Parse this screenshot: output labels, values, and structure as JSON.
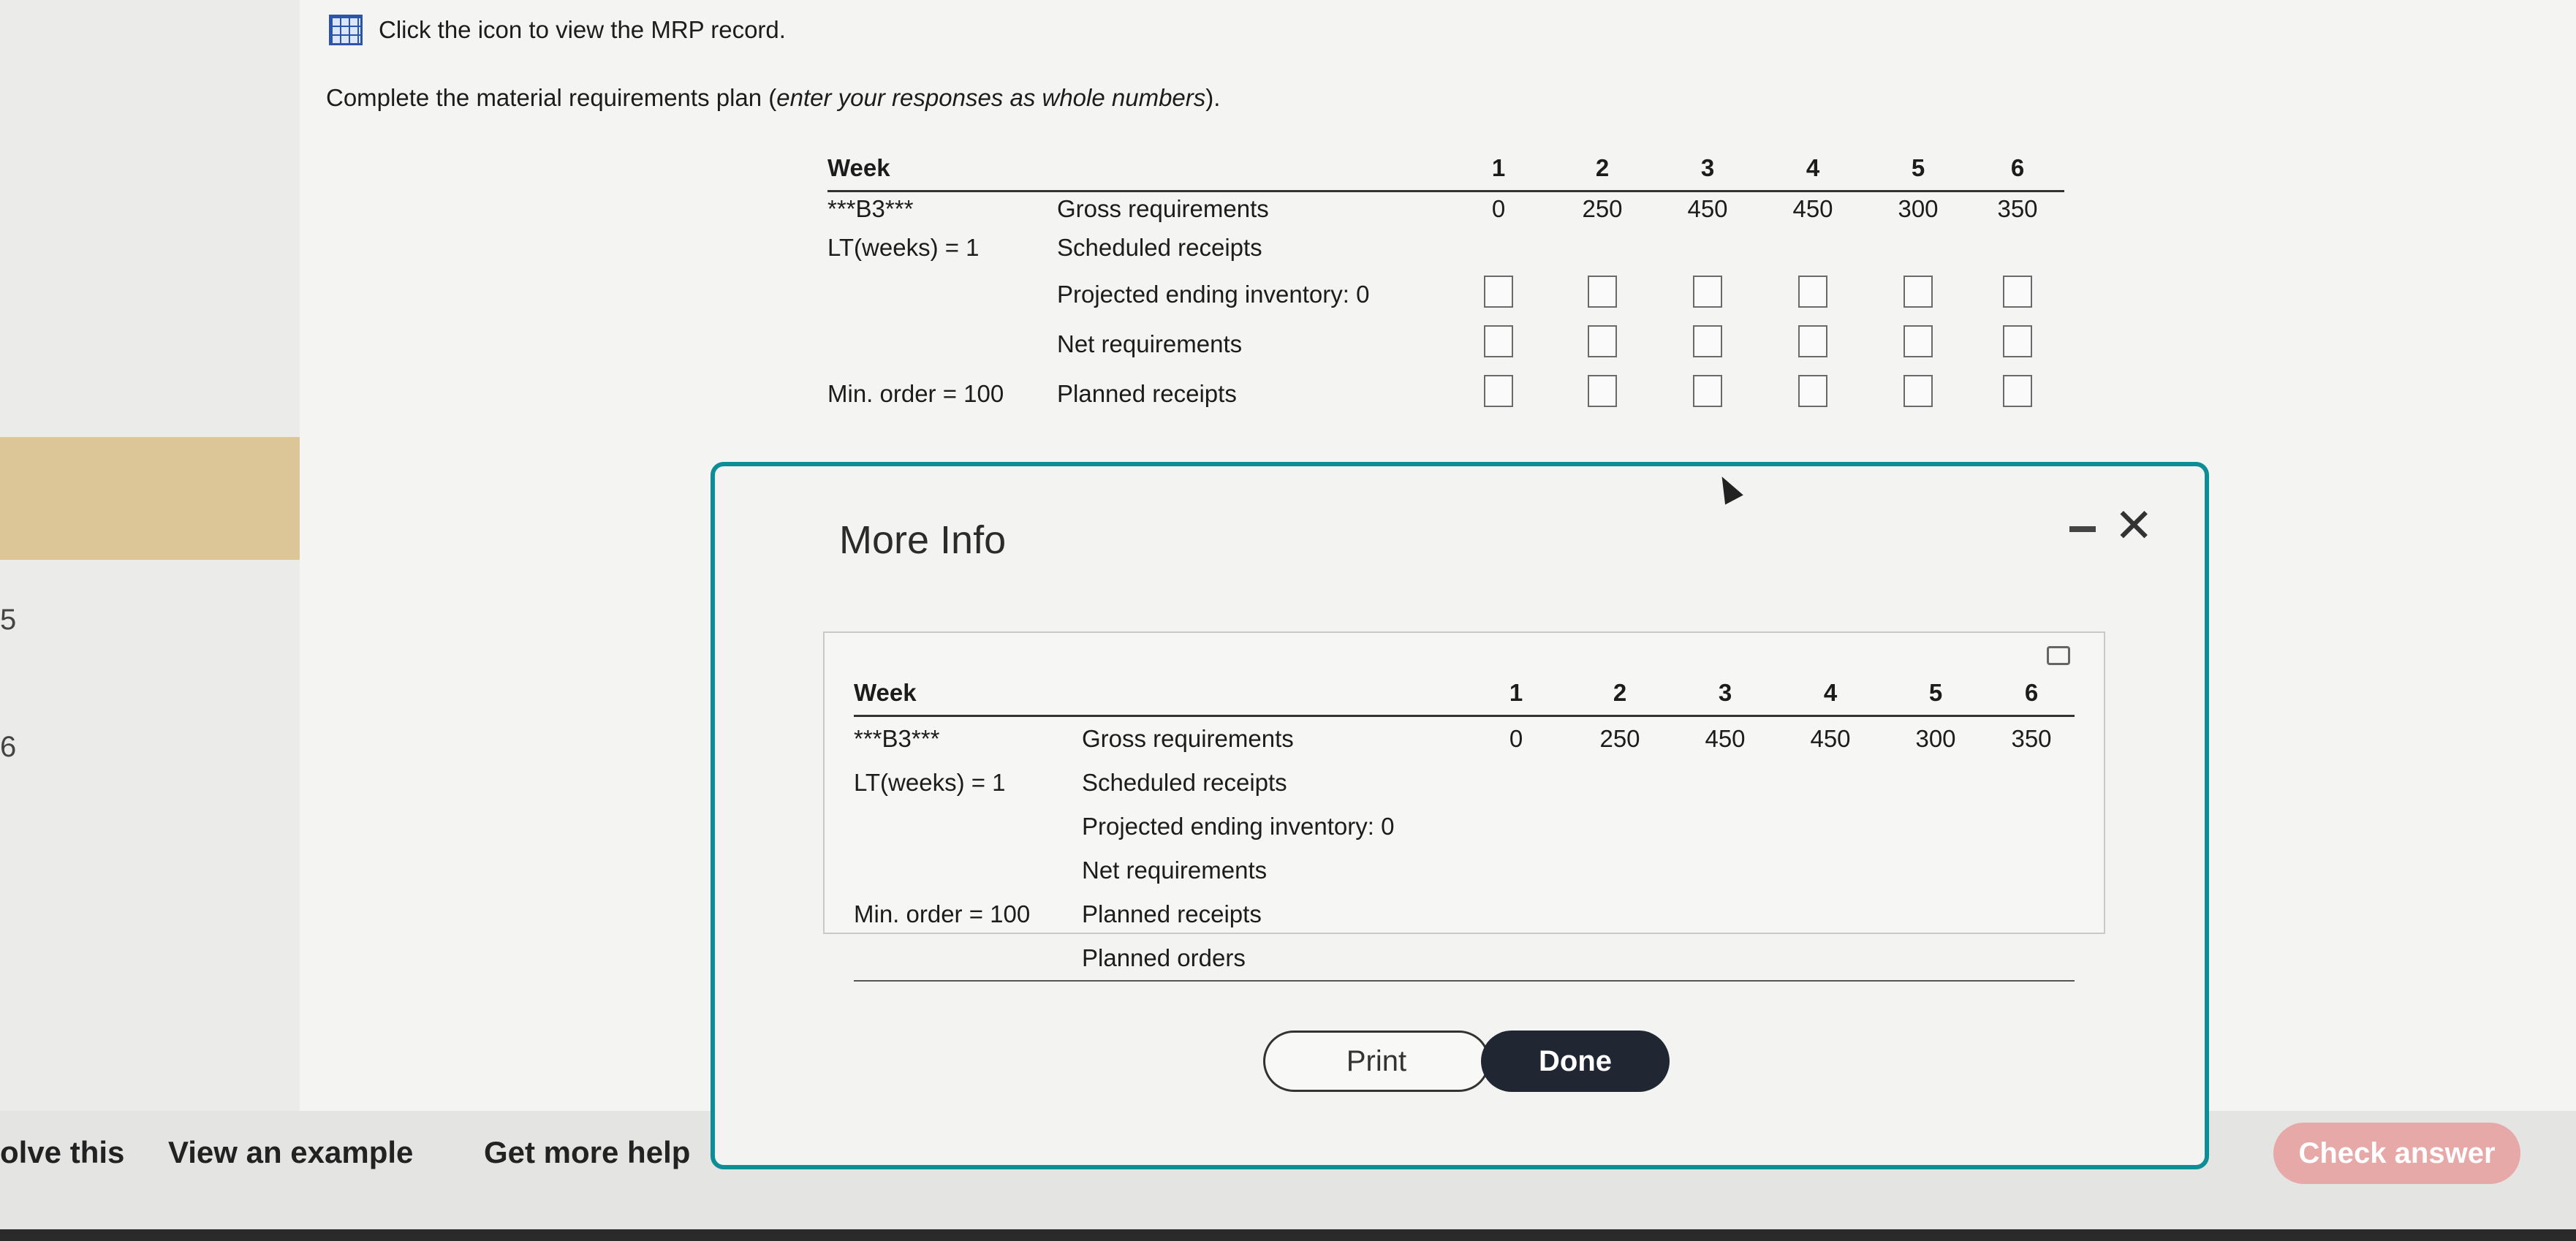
{
  "left_strip": {
    "numbers": [
      "5",
      "6"
    ]
  },
  "top_link": {
    "icon": "grid-icon",
    "text": "Click the icon to view the MRP record."
  },
  "instruction": {
    "prefix": "Complete the material requirements plan (",
    "emphasis": "enter your responses as whole numbers",
    "suffix": ")."
  },
  "mrp_table": {
    "week_label": "Week",
    "weeks": [
      "1",
      "2",
      "3",
      "4",
      "5",
      "6"
    ],
    "item": "***B3***",
    "lead_time": "LT(weeks) = 1",
    "min_order": "Min. order = 100",
    "rows": {
      "gross_requirements": "Gross requirements",
      "scheduled_receipts": "Scheduled receipts",
      "projected_ending_inventory": "Projected ending inventory: 0",
      "net_requirements": "Net requirements",
      "planned_receipts": "Planned receipts"
    },
    "gross_values": [
      "0",
      "250",
      "450",
      "450",
      "300",
      "350"
    ]
  },
  "modal": {
    "title": "More Info",
    "table": {
      "week_label": "Week",
      "weeks": [
        "1",
        "2",
        "3",
        "4",
        "5",
        "6"
      ],
      "item": "***B3***",
      "lead_time": "LT(weeks) = 1",
      "min_order": "Min. order = 100",
      "rows": {
        "gross_requirements": "Gross requirements",
        "scheduled_receipts": "Scheduled receipts",
        "projected_ending_inventory": "Projected ending inventory: 0",
        "net_requirements": "Net requirements",
        "planned_receipts": "Planned receipts",
        "planned_orders": "Planned orders"
      },
      "gross_values": [
        "0",
        "250",
        "450",
        "450",
        "300",
        "350"
      ]
    },
    "print_label": "Print",
    "done_label": "Done"
  },
  "footer": {
    "solve_label": "olve this",
    "example_label": "View an example",
    "help_label": "Get more help",
    "check_label": "Check answer"
  },
  "colors": {
    "modal_border": "#0d8d96",
    "done_button": "#202733",
    "check_button": "#e7a8a8"
  }
}
